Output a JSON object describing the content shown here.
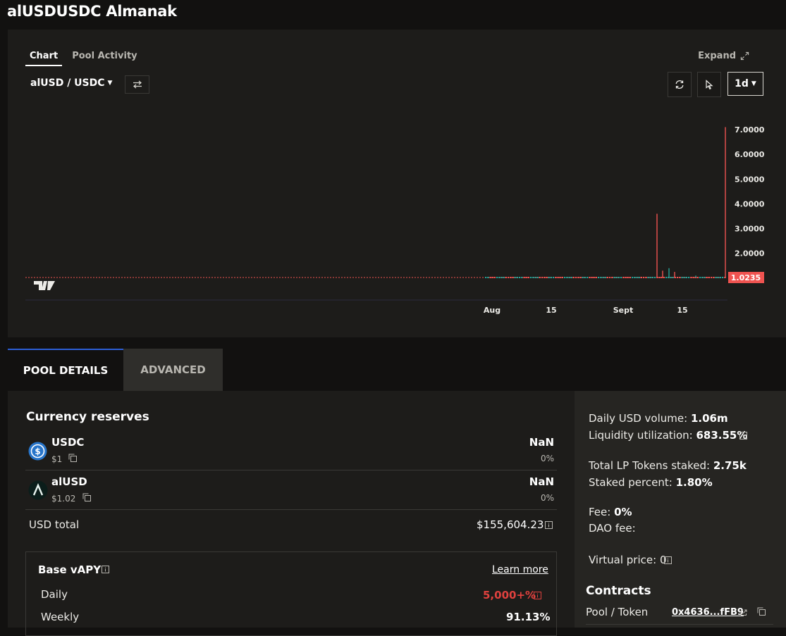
{
  "page": {
    "title": "alUSDUSDC Almanak"
  },
  "chart_panel": {
    "tabs": [
      "Chart",
      "Pool Activity"
    ],
    "active_tab": "Chart",
    "expand_label": "Expand",
    "pair": "alUSD / USDC",
    "interval": "1d",
    "icons": [
      "swap-icon",
      "refresh-icon",
      "cursor-icon",
      "expand-icon",
      "tradingview-logo"
    ]
  },
  "chart_data": {
    "type": "candlestick",
    "price_ticks": [
      "7.0000",
      "6.0000",
      "5.0000",
      "4.0000",
      "3.0000",
      "2.0000"
    ],
    "price_tick_values": [
      7,
      6,
      5,
      4,
      3,
      2
    ],
    "time_ticks": [
      "Aug",
      "15",
      "Sept",
      "15"
    ],
    "current_price": "1.0235",
    "current_price_value": 1.0235,
    "ylim": [
      1.0,
      7.2
    ],
    "colors": {
      "up": "#26a69a",
      "down": "#ef5350",
      "price_line": "#ef5350"
    },
    "spikes": [
      {
        "label": "Sep 10",
        "high": 3.6,
        "color": "down"
      },
      {
        "label": "Sep 11",
        "high": 1.4,
        "color": "up"
      },
      {
        "label": "Sep 13",
        "high": 1.3,
        "color": "down"
      },
      {
        "label": "Sep 14",
        "high": 1.25,
        "color": "down"
      },
      {
        "label": "Sep 18",
        "high": 1.1,
        "color": "up"
      },
      {
        "label": "Sep 24",
        "high": 7.1,
        "color": "down"
      }
    ]
  },
  "tabs": {
    "pool_details": "POOL DETAILS",
    "advanced": "ADVANCED"
  },
  "reserves": {
    "title": "Currency reserves",
    "coins": [
      {
        "name": "USDC",
        "price": "$1",
        "amount": "NaN",
        "percent": "0%",
        "icon": "usdc-icon"
      },
      {
        "name": "alUSD",
        "price": "$1.02",
        "amount": "NaN",
        "percent": "0%",
        "icon": "alusd-icon"
      }
    ],
    "usd_total_label": "USD total",
    "usd_total_value": "$155,604.23"
  },
  "vapy": {
    "title": "Base vAPY",
    "learn_more": "Learn more",
    "rows": [
      {
        "label": "Daily",
        "value": "5,000+%"
      },
      {
        "label": "Weekly",
        "value": "91.13%"
      }
    ]
  },
  "stats": {
    "daily_volume_label": "Daily USD volume:",
    "daily_volume_value": "1.06m",
    "liquidity_label": "Liquidity utilization:",
    "liquidity_value": "683.55%",
    "lp_staked_label": "Total LP Tokens staked:",
    "lp_staked_value": "2.75k",
    "staked_pct_label": "Staked percent:",
    "staked_pct_value": "1.80%",
    "fee_label": "Fee:",
    "fee_value": "0%",
    "dao_fee_label": "DAO fee:",
    "virtual_price_label": "Virtual price:",
    "virtual_price_value": "0",
    "contracts_title": "Contracts",
    "pool_token_label": "Pool / Token",
    "pool_token_address": "0x4636...fFB9"
  }
}
